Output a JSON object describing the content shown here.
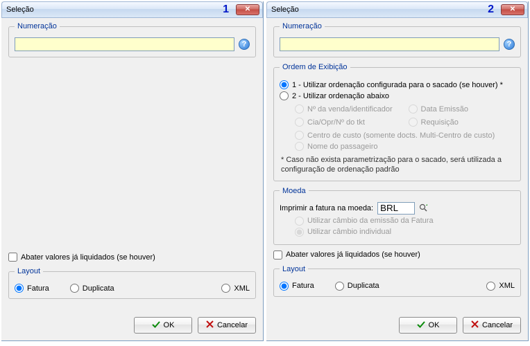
{
  "dialogs": [
    {
      "badge": "1",
      "title": "Seleção",
      "numeracao_legend": "Numeração",
      "numeracao_value": "",
      "abater_label": "Abater valores já liquidados (se houver)",
      "layout_legend": "Layout",
      "layout_options": {
        "fatura": "Fatura",
        "duplicata": "Duplicata",
        "xml": "XML"
      },
      "ok_label": "OK",
      "cancel_label": "Cancelar"
    },
    {
      "badge": "2",
      "title": "Seleção",
      "numeracao_legend": "Numeração",
      "numeracao_value": "",
      "ordem_legend": "Ordem de Exibição",
      "ordem_opt1": "1 - Utilizar ordenação configurada para o sacado (se houver) *",
      "ordem_opt2": "2 - Utilizar ordenação abaixo",
      "ordem_sub": {
        "venda": "Nº da venda/identificador",
        "data": "Data Emissão",
        "cia": "Cia/Opr/Nº do tkt",
        "req": "Requisição",
        "centro": "Centro de custo (somente docts. Multi-Centro de custo)",
        "pax": "Nome do passageiro"
      },
      "ordem_note": "* Caso não exista parametrização para o sacado, será utilizada a configuração de ordenação padrão",
      "moeda_legend": "Moeda",
      "moeda_label": "Imprimir a fatura na moeda:",
      "moeda_value": "BRL",
      "moeda_opt1": "Utilizar câmbio da emissão da Fatura",
      "moeda_opt2": "Utilizar câmbio individual",
      "abater_label": "Abater valores já liquidados (se houver)",
      "layout_legend": "Layout",
      "layout_options": {
        "fatura": "Fatura",
        "duplicata": "Duplicata",
        "xml": "XML"
      },
      "ok_label": "OK",
      "cancel_label": "Cancelar"
    }
  ]
}
